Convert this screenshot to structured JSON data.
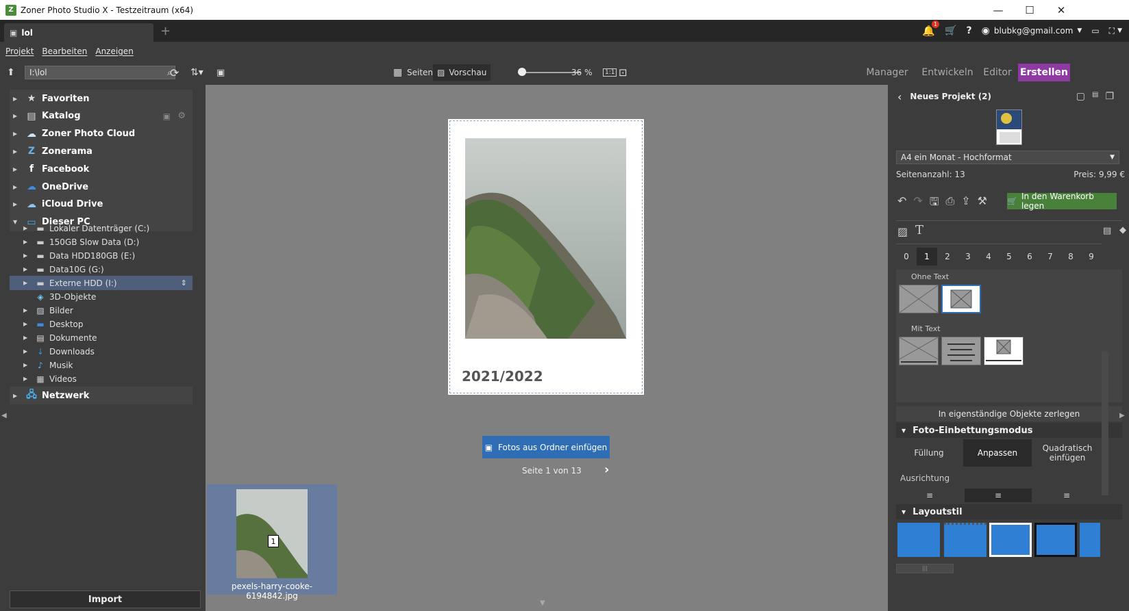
{
  "window": {
    "title": "Zoner Photo Studio X - Testzeitraum (x64)",
    "minimize": "—",
    "maximize": "☐",
    "close": "✕"
  },
  "tabs": {
    "active_label": "lol",
    "add": "+"
  },
  "header": {
    "notification_count": "1",
    "help": "?",
    "user_email": "blubkg@gmail.com"
  },
  "menu": {
    "items": [
      "Projekt",
      "Bearbeiten",
      "Anzeigen"
    ]
  },
  "toolbar": {
    "path": "I:\\lol",
    "view_pages": "Seiten",
    "view_preview": "Vorschau",
    "zoom_value": 36,
    "zoom_label": "36 %",
    "one_to_one": "1:1",
    "modes": [
      "Manager",
      "Entwickeln",
      "Editor",
      "Erstellen"
    ],
    "active_mode": "Erstellen"
  },
  "navigator": {
    "top_items": [
      {
        "label": "Favoriten",
        "icon": "star-icon"
      },
      {
        "label": "Katalog",
        "icon": "catalog-icon"
      },
      {
        "label": "Zoner Photo Cloud",
        "icon": "cloud-icon"
      },
      {
        "label": "Zonerama",
        "icon": "zonerama-icon"
      },
      {
        "label": "Facebook",
        "icon": "facebook-icon"
      },
      {
        "label": "OneDrive",
        "icon": "onedrive-icon"
      },
      {
        "label": "iCloud Drive",
        "icon": "icloud-icon"
      },
      {
        "label": "Dieser PC",
        "icon": "computer-icon"
      }
    ],
    "pc_items": [
      {
        "label": "Lokaler Datenträger (C:)",
        "icon": "drive-icon"
      },
      {
        "label": "150GB Slow Data (D:)",
        "icon": "drive-icon"
      },
      {
        "label": "Data HDD180GB (E:)",
        "icon": "drive-icon"
      },
      {
        "label": "Data10G (G:)",
        "icon": "drive-icon"
      },
      {
        "label": "Externe HDD (I:)",
        "icon": "drive-icon"
      },
      {
        "label": "3D-Objekte",
        "icon": "cube-icon"
      },
      {
        "label": "Bilder",
        "icon": "pictures-icon"
      },
      {
        "label": "Desktop",
        "icon": "desktop-icon"
      },
      {
        "label": "Dokumente",
        "icon": "document-icon"
      },
      {
        "label": "Downloads",
        "icon": "download-icon"
      },
      {
        "label": "Musik",
        "icon": "music-icon"
      },
      {
        "label": "Videos",
        "icon": "video-icon"
      }
    ],
    "network": {
      "label": "Netzwerk",
      "icon": "network-icon"
    },
    "import_label": "Import"
  },
  "canvas": {
    "caption": "2021/2022",
    "insert_button": "Fotos aus Ordner einfügen",
    "pager": "Seite 1 von 13"
  },
  "filmstrip": {
    "index": "1",
    "filename": "pexels-harry-cooke-6194842.jpg"
  },
  "project": {
    "title": "Neues Projekt (2)",
    "template": "A4 ein Monat - Hochformat",
    "page_count": "Seitenanzahl: 13",
    "price": "Preis: 9,99 €",
    "cart_button": "In den Warenkorb legen",
    "page_numbers": [
      "0",
      "1",
      "2",
      "3",
      "4",
      "5",
      "6",
      "7",
      "8",
      "9"
    ],
    "selected_page_number": "1",
    "without_text": "Ohne Text",
    "with_text": "Mit Text",
    "split_button": "In eigenständige Objekte zerlegen",
    "embed_heading": "Foto-Einbettungsmodus",
    "embed_modes": [
      "Füllung",
      "Anpassen",
      "Quadratisch einfügen"
    ],
    "active_embed_mode": "Anpassen",
    "alignment_label": "Ausrichtung",
    "layout_style_heading": "Layoutstil"
  },
  "colors": {
    "accent_create": "#8e3aa3",
    "button_blue": "#2f6db5",
    "cart_green": "#47813a",
    "selection": "#677c9e"
  }
}
